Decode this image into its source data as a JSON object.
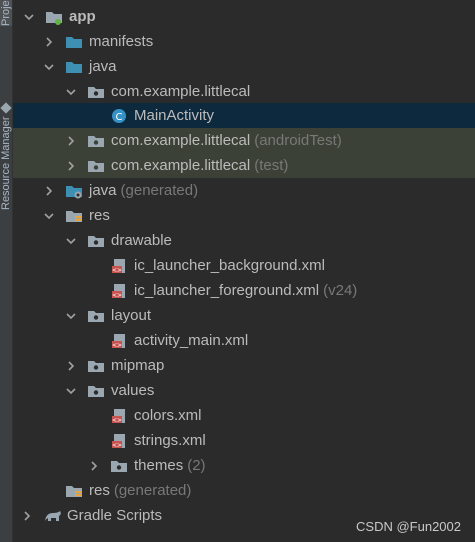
{
  "sidebar": {
    "project_tab": "Project",
    "resource_tab": "Resource Manager"
  },
  "tree": {
    "app": "app",
    "manifests": "manifests",
    "java": "java",
    "pkg_main": "com.example.littlecal",
    "main_activity": "MainActivity",
    "pkg_android_test": "com.example.littlecal",
    "pkg_android_test_suffix": "(androidTest)",
    "pkg_test": "com.example.littlecal",
    "pkg_test_suffix": "(test)",
    "java_generated": "java",
    "java_generated_suffix": "(generated)",
    "res": "res",
    "drawable": "drawable",
    "ic_bg": "ic_launcher_background.xml",
    "ic_fg": "ic_launcher_foreground.xml",
    "ic_fg_suffix": "(v24)",
    "layout": "layout",
    "activity_main": "activity_main.xml",
    "mipmap": "mipmap",
    "values": "values",
    "colors": "colors.xml",
    "strings": "strings.xml",
    "themes": "themes",
    "themes_suffix": "(2)",
    "res_generated": "res",
    "res_generated_suffix": "(generated)",
    "gradle_scripts": "Gradle Scripts"
  },
  "watermark": "CSDN @Fun2002",
  "colors": {
    "background": "#2b2b2b",
    "selected_row": "#0d293e",
    "test_rows": "#3b4136",
    "folder_blue": "#3d8fb3",
    "folder_gray": "#9aa7b0",
    "xml_red": "#c75450"
  }
}
